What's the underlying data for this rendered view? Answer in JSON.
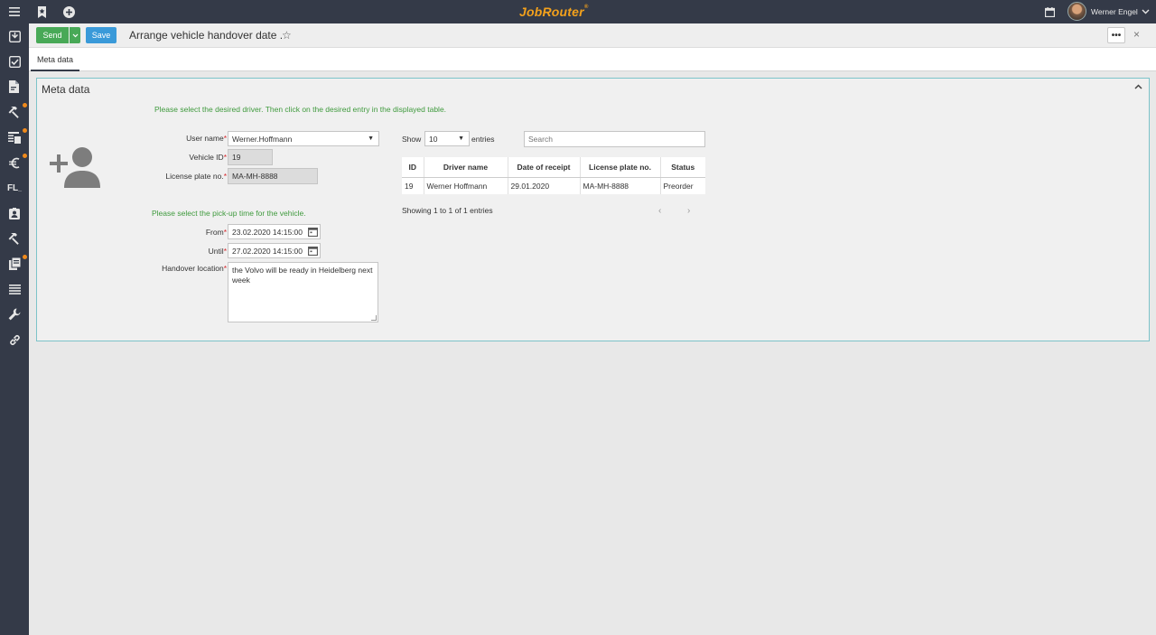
{
  "app": {
    "logo": "JobRouter",
    "user_name": "Werner Engel"
  },
  "toolbar": {
    "send_label": "Send",
    "save_label": "Save",
    "title": "Arrange vehicle handover date .",
    "more_label": "•••",
    "close_label": "×"
  },
  "tabs": [
    {
      "label": "Meta data",
      "active": true
    }
  ],
  "panel": {
    "title": "Meta data",
    "driver_hint": "Please select the desired driver. Then click on the desired entry in the displayed table.",
    "pickup_hint": "Please select the pick-up time for the vehicle.",
    "fields": {
      "user_name": {
        "label": "User name",
        "value": "Werner.Hoffmann"
      },
      "vehicle_id": {
        "label": "Vehicle ID",
        "value": "19"
      },
      "license_plate": {
        "label": "License plate no.",
        "value": "MA-MH-8888"
      },
      "from": {
        "label": "From",
        "value": "23.02.2020 14:15:00"
      },
      "until": {
        "label": "Until",
        "value": "27.02.2020 14:15:00"
      },
      "handover_location": {
        "label": "Handover location",
        "value": "the Volvo will be ready in Heidelberg next week"
      }
    },
    "table_controls": {
      "show_label": "Show",
      "entries_value": "10",
      "entries_label": "entries",
      "search_placeholder": "Search",
      "info": "Showing 1 to 1 of 1 entries"
    },
    "table": {
      "columns": [
        "ID",
        "Driver name",
        "Date of receipt",
        "License plate no.",
        "Status"
      ],
      "rows": [
        [
          "19",
          "Werner Hoffmann",
          "29.01.2020",
          "MA-MH-8888",
          "Preorder"
        ]
      ]
    }
  },
  "colors": {
    "sidebar": "#343a48",
    "accent": "#f3a11c",
    "send": "#48a957",
    "save": "#3a9ad9",
    "hint": "#3f9a3d",
    "panel_border": "#7cc3c9"
  }
}
